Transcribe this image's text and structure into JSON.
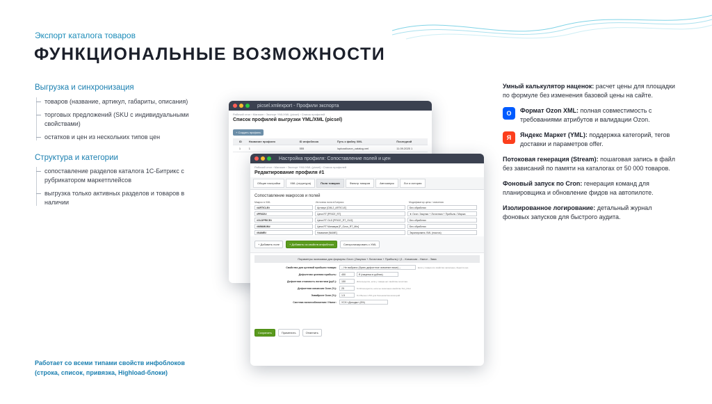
{
  "header": {
    "subtitle": "Экспорт каталога товаров",
    "title": "ФУНКЦИОНАЛЬНЫЕ ВОЗМОЖНОСТИ"
  },
  "left": {
    "section1": {
      "title": "Выгрузка и синхронизация",
      "items": [
        "товаров (название, артикул, габариты, описания)",
        "торговых предложений (SKU с индивидуальными свойствами)",
        "остатков и цен из нескольких типов цен"
      ]
    },
    "section2": {
      "title": "Структура и категории",
      "items": [
        "сопоставление разделов каталога 1С-Битрикс с рубрикатором маркетплейсов",
        "выгрузка только активных разделов и товаров в наличии"
      ]
    },
    "footnote": "Работает со всеми типами свойств инфоблоков (строка, список, привязка, Highload-блоки)"
  },
  "right": {
    "features": [
      {
        "bold": "Умный калькулятор наценок:",
        "text": " расчет цены для площадки по формуле без изменения базовой цены на сайте."
      },
      {
        "icon": "O",
        "icon_name": "ozon-logo-icon",
        "bold": "Формат Ozon XML:",
        "text": " полная совместимость с требованиями атрибутов и валидации Ozon."
      },
      {
        "icon": "Я",
        "icon_name": "yandex-logo-icon",
        "bold": "Яндекс Маркет (YML):",
        "text": " поддержка категорий, тегов доставки и параметров offer."
      },
      {
        "bold": "Потоковая генерация (Stream):",
        "text": " пошаговая запись в файл без зависаний по памяти на каталогах от 50 000 товаров."
      },
      {
        "bold": "Фоновый запуск по Cron:",
        "text": " генерация команд для планировщика и обновление фидов на автопилоте."
      },
      {
        "bold": "Изолированное логирование:",
        "text": " детальный журнал фоновых запусков для быстрого аудита."
      }
    ]
  },
  "screen_back": {
    "window_title": "picsel.xmlexport - Профили экспорта",
    "crumbs": "Рабочий стол › Магазин › Экспорт YML/XML (picsel) › Список профилей",
    "heading": "Список профилей выгрузки YML/XML (picsel)",
    "add_button": "+ Создать профиль",
    "columns": [
      "",
      "ID",
      "Название профиля",
      "ID инфоблока",
      "Путь к файлу XML",
      "Последний"
    ],
    "row": [
      "",
      "1",
      "1",
      "555",
      "/upload/ozon_catalog.xml",
      "11.09.2025 1"
    ]
  },
  "screen_front": {
    "window_title": "Настройка профиля: Сопоставление полей и цен",
    "crumbs": "Рабочий стол › Магазин › Экспорт YML/XML (picsel) › Список профилей",
    "heading": "Редактирование профиля #1",
    "tabs": [
      "Общие настройки",
      "XML (структура)",
      "Поля товаров",
      "Фильтр товаров",
      "Автозапуск",
      "Лог и история"
    ],
    "panel_title": "Сопоставление макросов и полей",
    "map_headers": [
      "Макрос в XML",
      "Источник поля в Битрикс",
      "Модификатор цены / значения"
    ],
    "map_rows": [
      [
        "#ARTICLE#",
        "Артикул [CML2_ARTICLE]",
        "Без обработки"
      ],
      [
        "#PRICE#",
        "Цена RT [PRICE_RT]",
        "★ Ozon: Закупка + Логистика + Прибыль / Маржа"
      ],
      [
        "#OLDPRICE#",
        "Цена RT OLD [PRICE_RT_OLD]",
        "Без обработки"
      ],
      [
        "#MINIMUM#",
        "Цена RT Минимум [P_Ozon_RT_Min]",
        "Без обработки"
      ],
      [
        "#NAME#",
        "Название [NAME]",
        "Экранировать XML (macros)"
      ]
    ],
    "btn_add_field": "+ Добавить поле",
    "btn_add_from_iblock": "+ Добавить из свойств инфоблока",
    "btn_sync": "Синхронизировать с XML",
    "params_title": "Параметры экономики для формулы Ozon: (Закупка + Логистика + Прибыль) / (1 - Комиссия - Налог - Эква",
    "form": [
      {
        "label": "Свойство для целевой прибыли товара:",
        "value": "-- Не выбрано (брать дефолтное значение ниже) --",
        "note": "Если у товара это свойство заполнено, берется оно."
      },
      {
        "label": "Дефолтная целевая прибыль:",
        "value": "450",
        "select": "₽ (нацепка в рублях)",
        "note": ""
      },
      {
        "label": "Дефолтная стоимость логистики (руб.):",
        "value": "150",
        "note": "Используется, если у товара нет свойства логистики"
      },
      {
        "label": "Дефолтная комиссия Ozon (%):",
        "value": "25",
        "note": "% Используется, если не заполнено свойство Тип_Ozon"
      },
      {
        "label": "Эквайринг Ozon (%):",
        "value": "1.5",
        "note": "% Обычно 1.5% для большинства категорий"
      },
      {
        "label": "Система налогообложения / Налог:",
        "value": "УСН «Доходы» (6%)",
        "note": ""
      }
    ],
    "btn_save": "Сохранить",
    "btn_apply": "Применить",
    "btn_cancel": "Отменить"
  }
}
